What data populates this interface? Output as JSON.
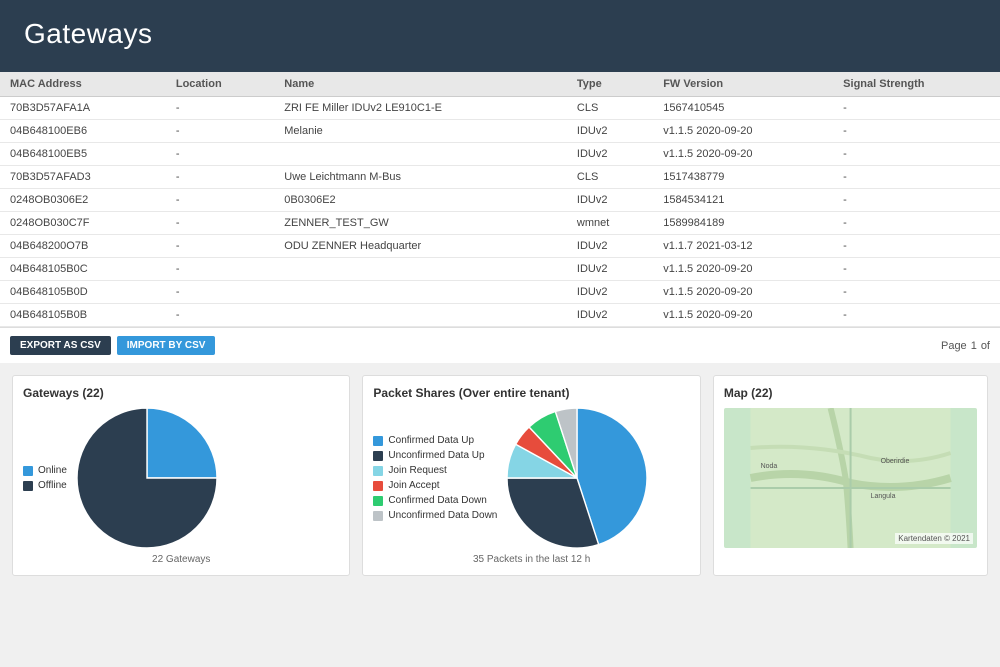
{
  "header": {
    "title": "Gateways"
  },
  "table": {
    "columns": [
      "MAC Address",
      "Location",
      "Name",
      "Type",
      "FW Version",
      "Signal Strength"
    ],
    "rows": [
      [
        "70B3D57AFA1A",
        "-",
        "ZRI FE Miller IDUv2 LE910C1-E",
        "CLS",
        "1567410545",
        "-"
      ],
      [
        "04B648100EB6",
        "-",
        "Melanie",
        "IDUv2",
        "v1.1.5 2020-09-20",
        "-"
      ],
      [
        "04B648100EB5",
        "-",
        "",
        "IDUv2",
        "v1.1.5 2020-09-20",
        "-"
      ],
      [
        "70B3D57AFAD3",
        "-",
        "Uwe Leichtmann M-Bus",
        "CLS",
        "1517438779",
        "-"
      ],
      [
        "0248OB0306E2",
        "-",
        "0B0306E2",
        "IDUv2",
        "1584534121",
        "-"
      ],
      [
        "0248OB030C7F",
        "-",
        "ZENNER_TEST_GW",
        "wmnet",
        "1589984189",
        "-"
      ],
      [
        "04B648200O7B",
        "-",
        "ODU ZENNER Headquarter",
        "IDUv2",
        "v1.1.7 2021-03-12",
        "-"
      ],
      [
        "04B648105B0C",
        "-",
        "",
        "IDUv2",
        "v1.1.5 2020-09-20",
        "-"
      ],
      [
        "04B648105B0D",
        "-",
        "",
        "IDUv2",
        "v1.1.5 2020-09-20",
        "-"
      ],
      [
        "04B648105B0B",
        "-",
        "",
        "IDUv2",
        "v1.1.5 2020-09-20",
        "-"
      ]
    ]
  },
  "actions": {
    "export_label": "EXPORT AS CSV",
    "import_label": "IMPORT BY CSV",
    "pagination": {
      "page_label": "Page",
      "current": "1",
      "of_label": "of"
    }
  },
  "gateways_chart": {
    "title": "Gateways (22)",
    "legend": [
      {
        "label": "Online",
        "color": "#3498db"
      },
      {
        "label": "Offline",
        "color": "#2c3e50"
      }
    ],
    "footer": "22 Gateways",
    "slices": [
      {
        "value": 25,
        "color": "#3498db"
      },
      {
        "value": 75,
        "color": "#2c3e50"
      }
    ]
  },
  "packets_chart": {
    "title": "Packet Shares (Over entire tenant)",
    "legend": [
      {
        "label": "Confirmed Data Up",
        "color": "#3498db"
      },
      {
        "label": "Unconfirmed Data Up",
        "color": "#2c3e50"
      },
      {
        "label": "Join Request",
        "color": "#85d5e5"
      },
      {
        "label": "Join Accept",
        "color": "#e74c3c"
      },
      {
        "label": "Confirmed Data Down",
        "color": "#2ecc71"
      },
      {
        "label": "Unconfirmed Data Down",
        "color": "#bdc3c7"
      }
    ],
    "footer": "35 Packets in the last 12 h",
    "slices": [
      {
        "value": 45,
        "color": "#3498db"
      },
      {
        "value": 30,
        "color": "#2c3e50"
      },
      {
        "value": 8,
        "color": "#85d5e5"
      },
      {
        "value": 5,
        "color": "#e74c3c"
      },
      {
        "value": 7,
        "color": "#2ecc71"
      },
      {
        "value": 5,
        "color": "#bdc3c7"
      }
    ]
  },
  "map": {
    "title": "Map (22)",
    "copyright": "Kartendaten © 2021"
  }
}
